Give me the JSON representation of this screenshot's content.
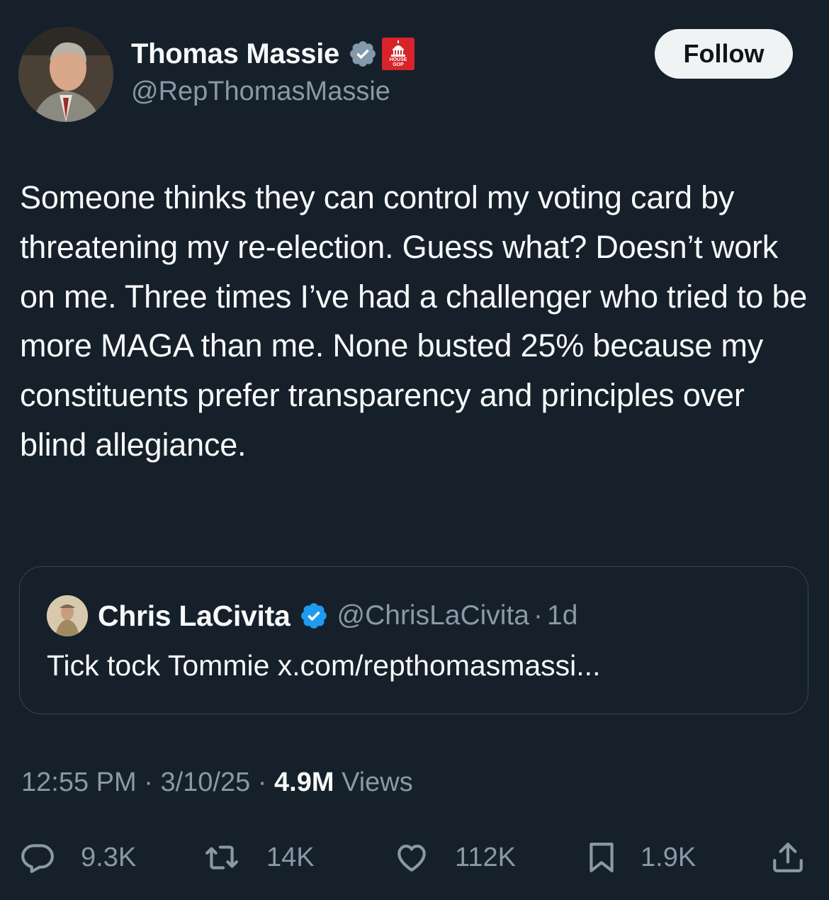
{
  "author": {
    "name": "Thomas Massie",
    "handle": "@RepThomasMassie",
    "follow_label": "Follow",
    "badges": [
      "verified-badge-icon",
      "gop-affiliation-icon"
    ],
    "affiliation_badge": {
      "top": "HOUSE",
      "bottom": "GOP"
    }
  },
  "tweet": {
    "text": "Someone thinks they can control my voting card by threatening my re-election. Guess what? Doesn’t work on me. Three times I’ve had a challenger who tried to be more MAGA than me. None busted 25% because my constituents prefer transparency and principles over blind allegiance."
  },
  "quoted": {
    "name": "Chris LaCivita",
    "handle": "@ChrisLaCivita",
    "separator": "·",
    "time": "1d",
    "text": "Tick tock Tommie x.com/repthomasmassi..."
  },
  "meta": {
    "time": "12:55 PM",
    "sep1": "·",
    "date": "3/10/25",
    "sep2": "·",
    "views_count": "4.9M",
    "views_label": "Views"
  },
  "actions": {
    "replies": "9.3K",
    "reposts": "14K",
    "likes": "112K",
    "bookmarks": "1.9K"
  },
  "colors": {
    "background": "#15202b",
    "text": "#f7f9f9",
    "secondary": "#8b98a5",
    "verified": "#1d9bf0",
    "border": "#38444d"
  }
}
